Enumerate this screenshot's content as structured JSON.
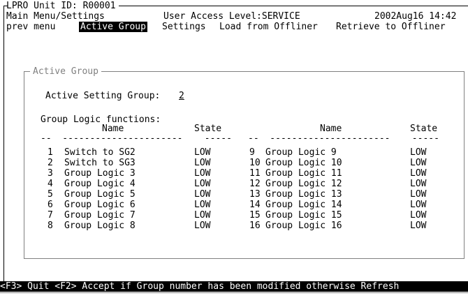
{
  "header": {
    "unit_id": "LPRO Unit ID: R00001",
    "breadcrumb": "Main Menu/Settings",
    "access_level": "User Access Level:SERVICE",
    "datetime": "2002Aug16 14:42"
  },
  "menu": {
    "items": [
      "prev menu",
      "Active Group",
      "Settings",
      "Load from Offliner",
      "Retrieve to Offliner"
    ],
    "active_index": 1
  },
  "panel": {
    "title": "Active Group",
    "active_setting_label": "Active Setting Group:",
    "active_setting_value": "2",
    "logic_heading": "Group Logic functions:",
    "col_name": "Name",
    "col_state": "State",
    "left_rows": [
      {
        "num": "1",
        "name": "Switch to SG2",
        "state": "LOW"
      },
      {
        "num": "2",
        "name": "Switch to SG3",
        "state": "LOW"
      },
      {
        "num": "3",
        "name": "Group Logic 3",
        "state": "LOW"
      },
      {
        "num": "4",
        "name": "Group Logic 4",
        "state": "LOW"
      },
      {
        "num": "5",
        "name": "Group Logic 5",
        "state": "LOW"
      },
      {
        "num": "6",
        "name": "Group Logic 6",
        "state": "LOW"
      },
      {
        "num": "7",
        "name": "Group Logic 7",
        "state": "LOW"
      },
      {
        "num": "8",
        "name": "Group Logic 8",
        "state": "LOW"
      }
    ],
    "right_rows": [
      {
        "num": "9",
        "name": "Group Logic 9",
        "state": "LOW"
      },
      {
        "num": "10",
        "name": "Group Logic 10",
        "state": "LOW"
      },
      {
        "num": "11",
        "name": "Group Logic 11",
        "state": "LOW"
      },
      {
        "num": "12",
        "name": "Group Logic 12",
        "state": "LOW"
      },
      {
        "num": "13",
        "name": "Group Logic 13",
        "state": "LOW"
      },
      {
        "num": "14",
        "name": "Group Logic 14",
        "state": "LOW"
      },
      {
        "num": "15",
        "name": "Group Logic 15",
        "state": "LOW"
      },
      {
        "num": "16",
        "name": "Group Logic 16",
        "state": "LOW"
      }
    ]
  },
  "status_bar": {
    "text": "<F3> Quit <F2> Accept if Group number has been modified otherwise Refresh"
  }
}
